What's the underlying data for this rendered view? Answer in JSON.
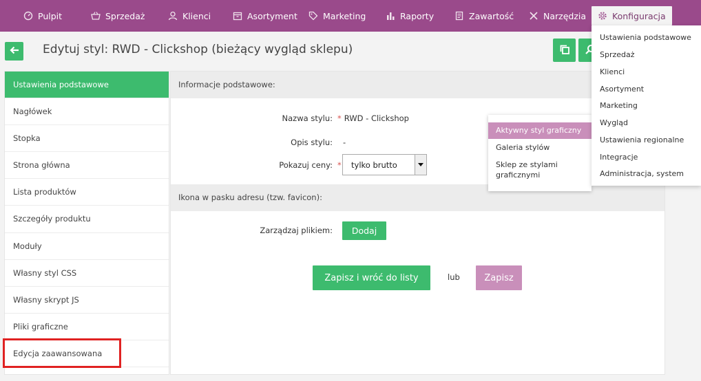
{
  "nav": {
    "items": [
      {
        "label": "Pulpit",
        "icon": "dashboard-icon"
      },
      {
        "label": "Sprzedaż",
        "icon": "basket-icon"
      },
      {
        "label": "Klienci",
        "icon": "users-icon"
      },
      {
        "label": "Asortyment",
        "icon": "box-icon"
      },
      {
        "label": "Marketing",
        "icon": "tag-icon"
      },
      {
        "label": "Raporty",
        "icon": "bar-chart-icon"
      },
      {
        "label": "Zawartość",
        "icon": "document-icon"
      },
      {
        "label": "Narzędzia",
        "icon": "tools-icon"
      },
      {
        "label": "Konfiguracja",
        "icon": "gear-icon"
      }
    ]
  },
  "header": {
    "title": "Edytuj styl: RWD - Clickshop (bieżący wygląd sklepu)"
  },
  "sidebar": {
    "items": [
      "Ustawienia podstawowe",
      "Nagłówek",
      "Stopka",
      "Strona główna",
      "Lista produktów",
      "Szczegóły produktu",
      "Moduły",
      "Własny styl CSS",
      "Własny skrypt JS",
      "Pliki graficzne",
      "Edycja zaawansowana"
    ]
  },
  "form": {
    "section_basic": "Informacje podstawowe:",
    "style_name_label": "Nazwa stylu:",
    "style_name_value": "RWD - Clickshop",
    "style_desc_label": "Opis stylu:",
    "style_desc_value": "-",
    "prices_label": "Pokazuj ceny:",
    "prices_value": "tylko brutto",
    "section_favicon": "Ikona w pasku adresu (tzw. favicon):",
    "file_label": "Zarządzaj plikiem:",
    "add_button": "Dodaj",
    "save_return_button": "Zapisz i wróć do listy",
    "or_text": "lub",
    "save_button": "Zapisz"
  },
  "style_menu": {
    "items": [
      "Aktywny styl graficzny",
      "Galeria stylów",
      "Sklep ze stylami graficznymi"
    ]
  },
  "config_menu": {
    "items": [
      "Ustawienia podstawowe",
      "Sprzedaż",
      "Klienci",
      "Asortyment",
      "Marketing",
      "Wygląd",
      "Ustawienia regionalne",
      "Integracje",
      "Administracja, system"
    ]
  },
  "colors": {
    "nav_bg": "#9a4a8b",
    "accent_green": "#3dbb6e",
    "accent_pink": "#c98fba",
    "highlight_red": "#e02222"
  }
}
